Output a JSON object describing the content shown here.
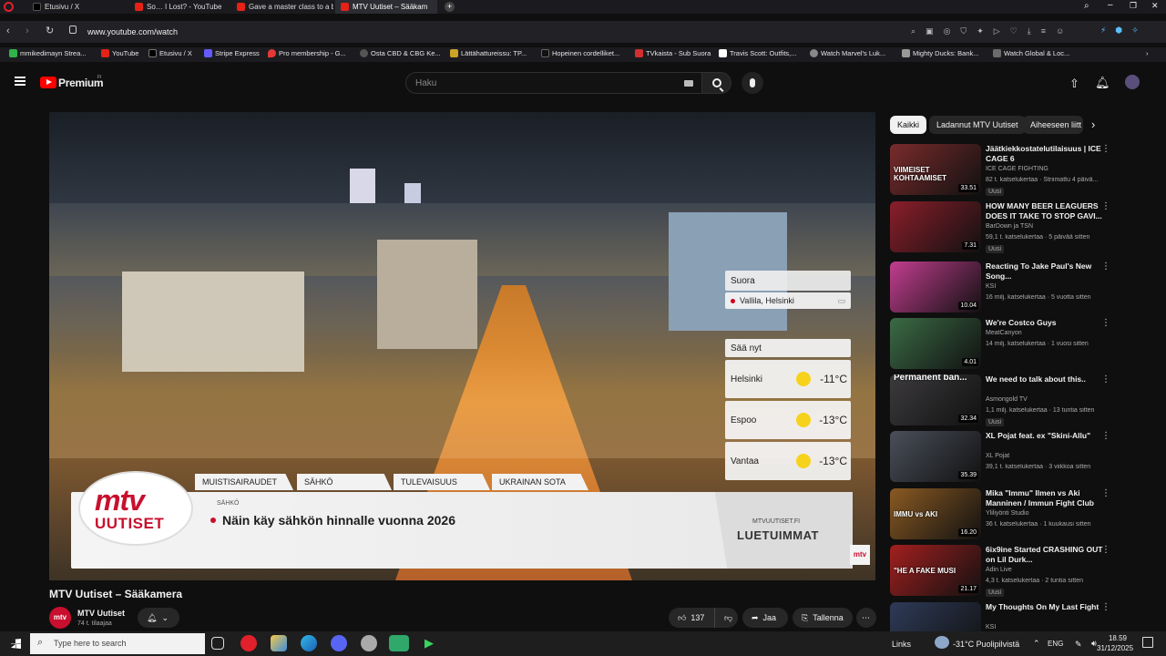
{
  "browser": {
    "tabs": [
      {
        "label": "Etusivu / X",
        "color": "#000"
      },
      {
        "label": "So… I Lost? - YouTube",
        "color": "#e62117"
      },
      {
        "label": "Gave a master class to a b",
        "color": "#e62117"
      },
      {
        "label": "MTV Uutiset – Sääkam",
        "color": "#e62117"
      }
    ],
    "url": "www.youtube.com/watch",
    "bookmarks": [
      "mmikedimayn Strea...",
      "YouTube",
      "Etusivu / X",
      "Stripe Express",
      "Pro membership - G...",
      "Osta CBD & CBG Ke...",
      "Lättähattureissu: TP...",
      "Hopeinen cordelliket...",
      "TVkaista - Sub Suora",
      "Travis Scott: Outfits,...",
      "Watch Marvel's Luk...",
      "Mighty Ducks: Bank...",
      "Watch Global & Loc..."
    ]
  },
  "youtube": {
    "logo": "Premium",
    "logo_sup": "FI",
    "search_placeholder": "Haku"
  },
  "video": {
    "live_label": "Suora",
    "location": "Vallila, Helsinki",
    "weather_header": "Sää nyt",
    "weather": [
      {
        "city": "Helsinki",
        "temp": "-11°C"
      },
      {
        "city": "Espoo",
        "temp": "-13°C"
      },
      {
        "city": "Vantaa",
        "temp": "-13°C"
      }
    ],
    "news_tabs": [
      "MUISTISAIRAUDET",
      "SÄHKÖ",
      "TULEVAISUUS",
      "UKRAINAN SOTA"
    ],
    "logo_line1": "mtv",
    "logo_line2": "UUTISET",
    "ticker_category": "SÄHKÖ",
    "ticker_headline": "Näin käy sähkön hinnalle vuonna 2026",
    "site": "MTVUUTISET.FI",
    "luetuimmat": "LUETUIMMAT",
    "corner": "mtv"
  },
  "watch": {
    "title": "MTV Uutiset – Sääkamera",
    "channel": "MTV Uutiset",
    "subscribers": "74 t. tilaajaa",
    "likes": "137",
    "share": "Jaa",
    "save": "Tallenna"
  },
  "sidebar": {
    "chips": [
      "Kaikki",
      "Ladannut MTV Uutiset",
      "Aiheeseen liitt"
    ],
    "items": [
      {
        "title": "Jäätkiekkostatelutilaisuus | ICE CAGE 6",
        "channel": "ICE CAGE FIGHTING",
        "meta": "82 t. katselukertaa · Striimattu 4 päivä...",
        "badge": "Uusi",
        "duration": "33.51",
        "thumb": "#7a2b2b",
        "overlay": "VIIMEISET KOHTAAMISET"
      },
      {
        "title": "HOW MANY BEER LEAGUERS DOES IT TAKE TO STOP GAVI...",
        "channel": "BarDown ja TSN",
        "meta": "59,1 t. katselukertaa · 5 päivää sitten",
        "badge": "Uusi",
        "duration": "7.31",
        "thumb": "#8b1e2a",
        "overlay": ""
      },
      {
        "title": "Reacting To Jake Paul's New Song...",
        "channel": "KSI",
        "meta": "16 milj. katselukertaa · 5 vuotta sitten",
        "badge": "",
        "duration": "10.04",
        "thumb": "#c23d8f",
        "overlay": ""
      },
      {
        "title": "We're Costco Guys",
        "channel": "MeatCanyon",
        "meta": "14 milj. katselukertaa · 1 vuosi sitten",
        "badge": "",
        "duration": "4.01",
        "thumb": "#3b6b45",
        "overlay": ""
      },
      {
        "title": "We need to talk about this..",
        "channel": "Asmongold TV",
        "meta": "1,1 milj. katselukertaa · 13 tuntia sitten",
        "badge": "Uusi",
        "duration": "32.34",
        "thumb": "#3c3a3d",
        "overlay": "Permanent ban..."
      },
      {
        "title": "XL Pojat feat. ex \"Skini-Allu\"",
        "channel": "XL Pojat",
        "meta": "39,1 t. katselukertaa · 3 viikkoa sitten",
        "badge": "",
        "duration": "35.39",
        "thumb": "#4a4f5a",
        "overlay": ""
      },
      {
        "title": "Mika \"Immu\" Ilmen vs Aki Manninen / Immun Fight Club",
        "channel": "Yliliyönti Studio",
        "meta": "36 t. katselukertaa · 1 kuukausi sitten",
        "badge": "",
        "duration": "16.20",
        "thumb": "#8a5a22",
        "overlay": "IMMU vs AKI"
      },
      {
        "title": "6ix9ine Started CRASHING OUT on Lil Durk...",
        "channel": "Adin Live",
        "meta": "4,3 t. katselukertaa · 2 tuntia sitten",
        "badge": "Uusi",
        "duration": "21.17",
        "thumb": "#a31f1f",
        "overlay": "\"HE A FAKE MUSI"
      },
      {
        "title": "My Thoughts On My Last Fight",
        "channel": "KSI",
        "meta": "",
        "badge": "",
        "duration": "",
        "thumb": "#2e3b58",
        "overlay": ""
      }
    ]
  },
  "taskbar": {
    "search": "Type here to search",
    "links": "Links",
    "weather": "-31°C  Puolipilvistä",
    "lang": "ENG",
    "time": "18.59",
    "date": "31/12/2025"
  }
}
